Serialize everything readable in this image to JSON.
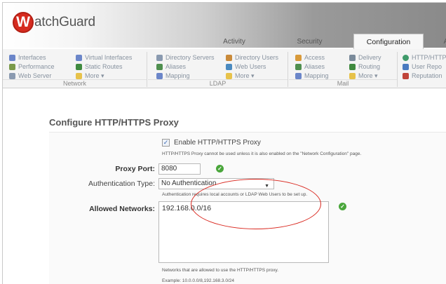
{
  "logo": {
    "mark": "W",
    "text": "atchGuard"
  },
  "tabs": [
    {
      "label": "Activity"
    },
    {
      "label": "Security"
    },
    {
      "label": "Configuration"
    },
    {
      "label": "A"
    }
  ],
  "ribbon": {
    "network": {
      "label": "Network",
      "items": [
        "Interfaces",
        "Performance",
        "Web Server",
        "Virtual Interfaces",
        "Static Routes",
        "More ▾"
      ]
    },
    "ldap": {
      "label": "LDAP",
      "items": [
        "Directory Servers",
        "Aliases",
        "Mapping",
        "Directory Users",
        "Web Users",
        "More ▾"
      ]
    },
    "mail": {
      "label": "Mail",
      "items": [
        "Access",
        "Aliases",
        "Mapping",
        "Delivery",
        "Routing",
        "More ▾"
      ]
    },
    "other": {
      "items": [
        "HTTP/HTTPS Pr",
        "User Repo",
        "Reputation"
      ]
    }
  },
  "page": {
    "title": "Configure HTTP/HTTPS Proxy",
    "enable_label": "Enable HTTP/HTTPS Proxy",
    "enable_checked": true,
    "enable_note": "HTTP/HTTPS Proxy cannot be used unless it is also enabled on the \"Network Configuration\" page.",
    "proxy_port_label": "Proxy Port:",
    "proxy_port_value": "8080",
    "auth_type_label": "Authentication Type:",
    "auth_type_value": "No Authentication",
    "auth_note": "Authentication requires local accounts or LDAP Web Users to be set up.",
    "allowed_networks_label": "Allowed Networks:",
    "allowed_networks_value": "192.168.0.0/16",
    "networks_note": "Networks that are allowed to use the HTTP/HTTPS proxy.",
    "example_note": "Example: 10.0.0.0/8,192.168.3.0/24"
  },
  "colors": {
    "accent_red": "#d62b1f",
    "ok_green": "#4aa63b",
    "annotation": "#d9251c"
  }
}
